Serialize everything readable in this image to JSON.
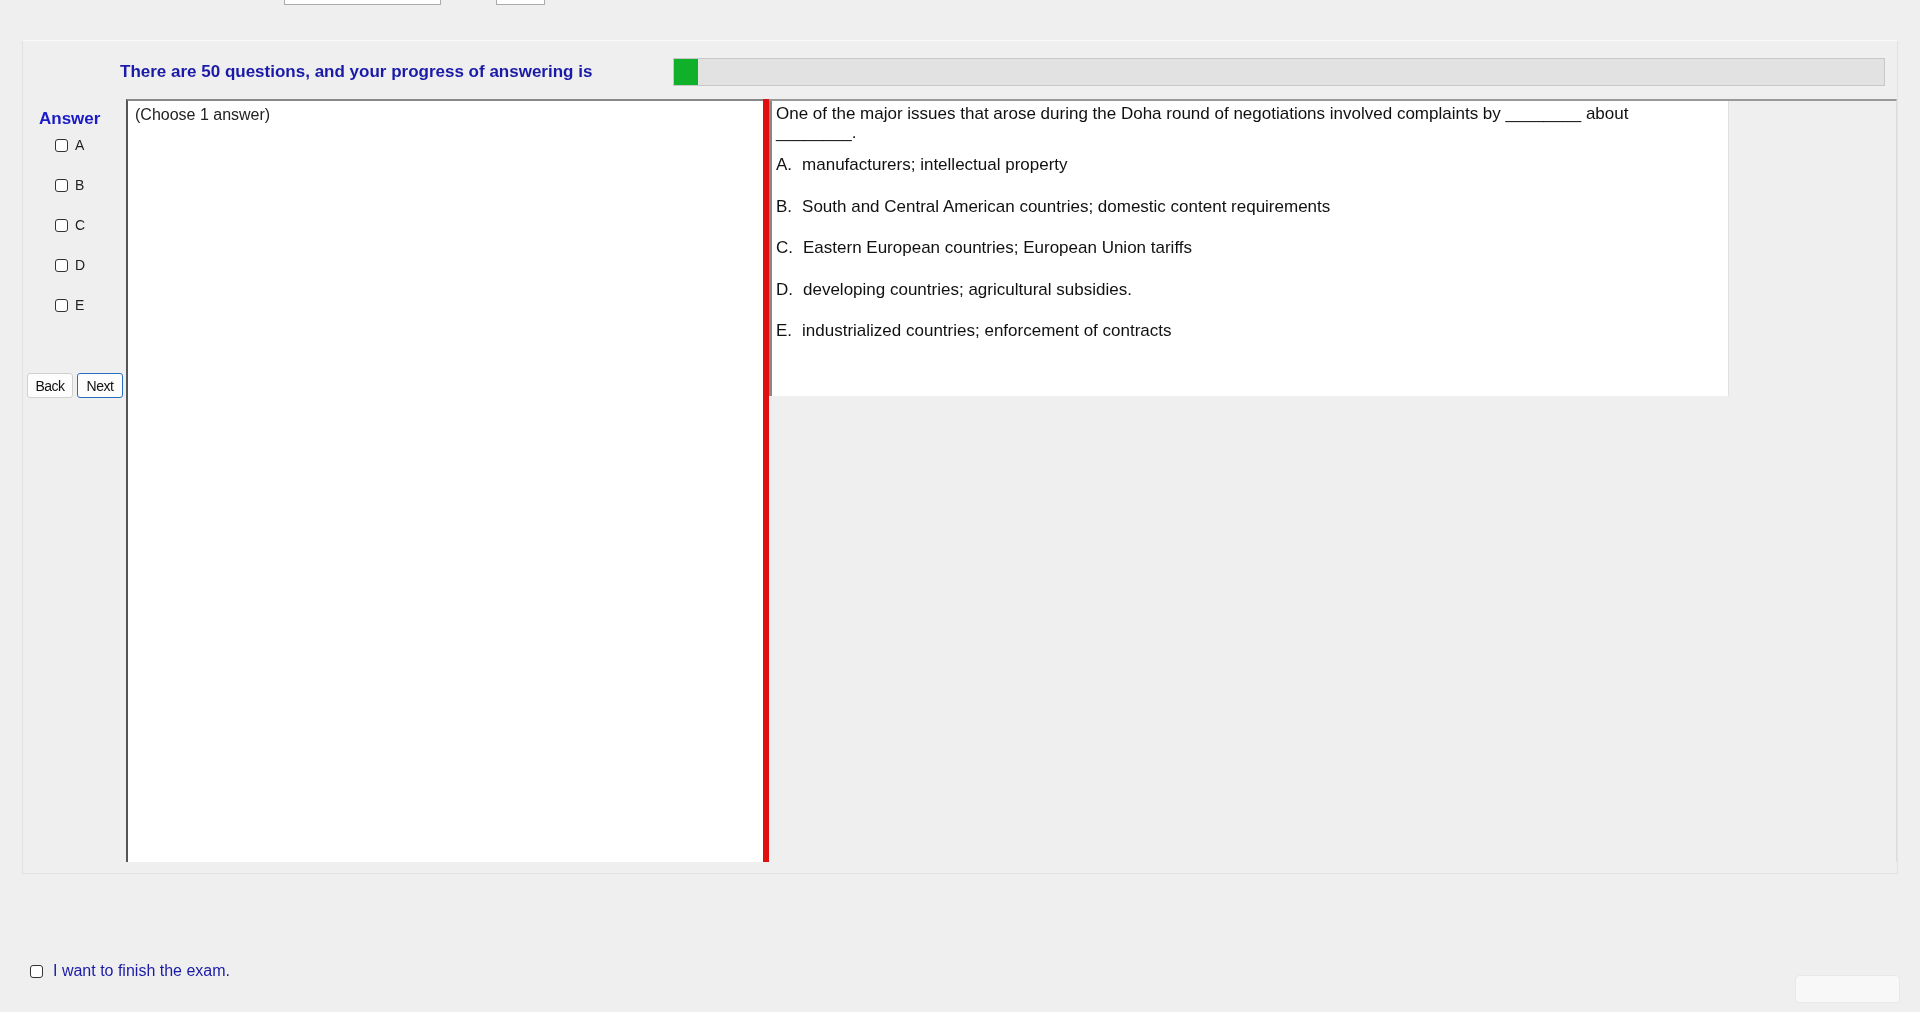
{
  "header": {
    "progress_label": "There are 50 questions, and your progress of answering is",
    "progress": {
      "level": 0.02
    }
  },
  "answer": {
    "label": "Answer",
    "options": [
      {
        "letter": "A",
        "checked": false
      },
      {
        "letter": "B",
        "checked": false
      },
      {
        "letter": "C",
        "checked": false
      },
      {
        "letter": "D",
        "checked": false
      },
      {
        "letter": "E",
        "checked": false
      }
    ]
  },
  "buttons": [
    {
      "label": "Back",
      "focused": false
    },
    {
      "label": "Next",
      "focused": true
    }
  ],
  "answer_box": {
    "text": "(Choose 1 answer)"
  },
  "question": {
    "text": "One of the major issues that arose during the Doha round of negotiations involved complaints by ________ about ________.",
    "choices": [
      {
        "letter": "A.",
        "text": "manufacturers; intellectual property"
      },
      {
        "letter": "B.",
        "text": "South and Central American countries; domestic content requirements"
      },
      {
        "letter": "C.",
        "text": "Eastern European countries; European Union tariffs"
      },
      {
        "letter": "D.",
        "text": "developing countries; agricultural subsidies."
      },
      {
        "letter": "E.",
        "text": "industrialized countries; enforcement of contracts"
      }
    ]
  },
  "finish": {
    "label": "I want to finish the exam.",
    "checked": false
  }
}
